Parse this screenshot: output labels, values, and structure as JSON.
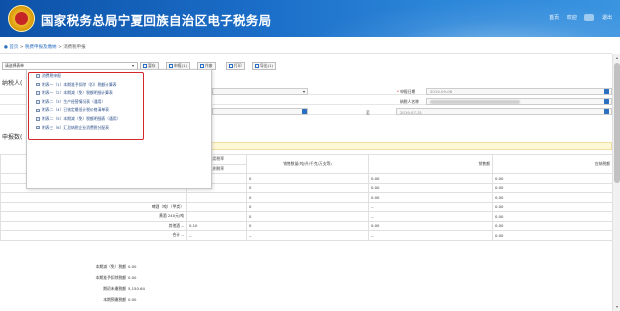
{
  "header": {
    "title": "国家税务总局宁夏回族自治区电子税务局",
    "home_label": "首页",
    "welcome_label": "欢迎",
    "logout_label": "退出"
  },
  "breadcrumb": {
    "home": "首页",
    "sep1": ">",
    "parent": "税费申报及缴纳",
    "sep2": ">",
    "current": "消费税申报"
  },
  "toolbar": {
    "select_value": "请选择表单",
    "save_label": "暂存",
    "report_label": "申报(1)",
    "delete_label": "作废",
    "print_label": "打印",
    "export_label": "导出(1)"
  },
  "dropdown": {
    "items": [
      "消费税申报",
      "附表一（1）本期准予扣除（扣）税额计算表",
      "附表一（2）本期减（免）税额明细计算表",
      "附表二（3）生产经营情况表（通用）",
      "附表二（4）已核定最低计税价格清单表",
      "附表二（5）本期减（免）税额明细表（通用）",
      "附表三（6）汇总纳税企业消费税分配表"
    ]
  },
  "form": {
    "taxpayer_section": "纳税人(",
    "date_label": "申报日期",
    "date_value": "2019-09-06",
    "name_label": "纳税人名称",
    "to_label": "至",
    "period_end": "2019-07-31",
    "declare_section": "申报数("
  },
  "table": {
    "headers": [
      "适用税率",
      "比例税率",
      "销售数量(吨/升/千克/万支等)",
      "销售额",
      "应纳税额"
    ],
    "rows": [
      {
        "label": "",
        "rate": "",
        "qty": "0",
        "amount": "0.00",
        "tax": "0.00"
      },
      {
        "label": "",
        "rate": "",
        "qty": "0",
        "amount": "0.00",
        "tax": "0.00"
      },
      {
        "label": "",
        "rate": "",
        "qty": "0",
        "amount": "0.00",
        "tax": "0.00"
      },
      {
        "label": "啤酒（吨）（甲类）",
        "rate": "",
        "qty": "0",
        "amount": "--",
        "tax": "0.00"
      },
      {
        "label": "黄酒 240元/吨",
        "rate": "",
        "qty": "0",
        "amount": "--",
        "tax": "0.00"
      },
      {
        "label": "其他酒 --",
        "rate": "0.10",
        "qty": "0",
        "amount": "0.00",
        "tax": "0.00"
      },
      {
        "label": "合计 --",
        "rate": "--",
        "qty": "--",
        "amount": "--",
        "tax": "0.00"
      }
    ]
  },
  "summary": [
    {
      "label": "本期减（免）税额",
      "value": "0.00"
    },
    {
      "label": "本期准予扣除税额",
      "value": "0.00"
    },
    {
      "label": "期初未缴税额",
      "value": "5,150.64"
    },
    {
      "label": "本期预缴税额",
      "value": "0.00"
    }
  ],
  "colors": {
    "header_blue": "#1a6cc6",
    "highlight_red": "#d4272a",
    "link_blue": "#2b6fc1"
  }
}
